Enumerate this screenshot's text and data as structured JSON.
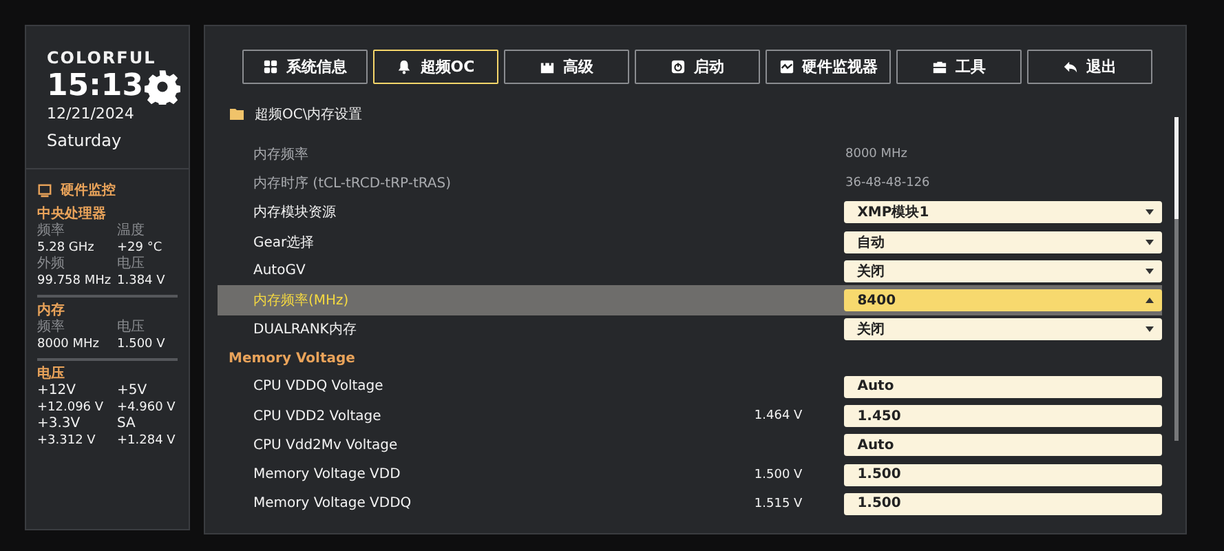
{
  "sidebar": {
    "brand": "COLORFUL",
    "time": "15:13",
    "date": "12/21/2024",
    "weekday": "Saturday",
    "monitor_title": "硬件监控",
    "groups": [
      {
        "title": "中央处理器",
        "items": [
          {
            "label": "频率",
            "value": "5.28 GHz"
          },
          {
            "label": "温度",
            "value": "+29 °C"
          },
          {
            "label": "外频",
            "value": "99.758 MHz"
          },
          {
            "label": "电压",
            "value": "1.384 V"
          }
        ]
      },
      {
        "title": "内存",
        "items": [
          {
            "label": "频率",
            "value": "8000 MHz"
          },
          {
            "label": "电压",
            "value": "1.500 V"
          }
        ]
      },
      {
        "title": "电压",
        "items": [
          {
            "label": "+12V",
            "value": "+12.096 V"
          },
          {
            "label": "+5V",
            "value": "+4.960 V"
          },
          {
            "label": "+3.3V",
            "value": "+3.312 V"
          },
          {
            "label": "SA",
            "value": "+1.284 V"
          }
        ]
      }
    ]
  },
  "tabs": [
    {
      "label": "系统信息",
      "selected": false
    },
    {
      "label": "超频OC",
      "selected": true
    },
    {
      "label": "高级",
      "selected": false
    },
    {
      "label": "启动",
      "selected": false
    },
    {
      "label": "硬件监视器",
      "selected": false
    },
    {
      "label": "工具",
      "selected": false
    },
    {
      "label": "退出",
      "selected": false
    }
  ],
  "breadcrumb": "超频OC\\内存设置",
  "rows": [
    {
      "kind": "info",
      "label": "内存频率",
      "value": "8000 MHz",
      "selected": false
    },
    {
      "kind": "info",
      "label": "内存时序 (tCL-tRCD-tRP-tRAS)",
      "value": "36-48-48-126",
      "selected": false
    },
    {
      "kind": "select",
      "label": "内存模块资源",
      "value": "XMP模块1",
      "selected": false
    },
    {
      "kind": "select",
      "label": "Gear选择",
      "value": "自动",
      "selected": false
    },
    {
      "kind": "select",
      "label": "AutoGV",
      "value": "关闭",
      "selected": false
    },
    {
      "kind": "select",
      "label": "内存频率(MHz)",
      "value": "8400",
      "selected": true
    },
    {
      "kind": "select",
      "label": "DUALRANK内存",
      "value": "关闭",
      "selected": false
    },
    {
      "kind": "section",
      "label": "Memory Voltage"
    },
    {
      "kind": "input",
      "label": "CPU VDDQ Voltage",
      "value": "Auto",
      "selected": false
    },
    {
      "kind": "input",
      "label": "CPU VDD2 Voltage",
      "reading": "1.464 V",
      "value": "1.450",
      "selected": false
    },
    {
      "kind": "input",
      "label": "CPU Vdd2Mv Voltage",
      "value": "Auto",
      "selected": false
    },
    {
      "kind": "input",
      "label": "Memory Voltage VDD",
      "reading": "1.500 V",
      "value": "1.500",
      "selected": false
    },
    {
      "kind": "input",
      "label": "Memory Voltage VDDQ",
      "reading": "1.515 V",
      "value": "1.500",
      "selected": false
    }
  ]
}
